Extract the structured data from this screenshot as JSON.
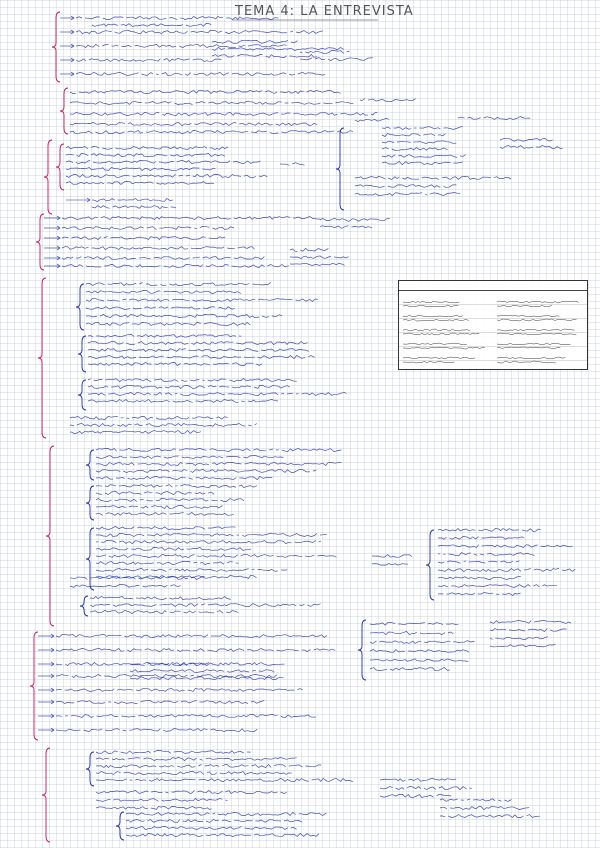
{
  "title": "TEMA 4: LA ENTREVISTA",
  "colors": {
    "ink": "#1f2fa8",
    "brace": "#c2185b",
    "label": "#5a2a7a"
  },
  "sections": [
    {
      "label": ""
    },
    {
      "label": ""
    },
    {
      "label": ""
    },
    {
      "label": ""
    },
    {
      "label": ""
    },
    {
      "label": ""
    },
    {
      "label": ""
    },
    {
      "label": ""
    },
    {
      "label": ""
    }
  ],
  "table": {
    "headers": [
      "",
      ""
    ],
    "rows": 5
  }
}
